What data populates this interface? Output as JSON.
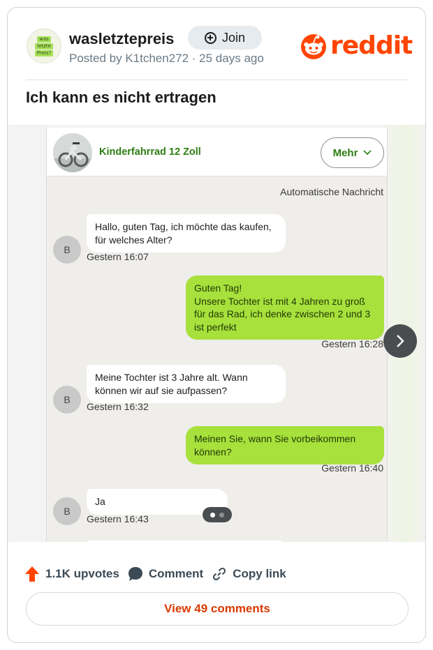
{
  "community": {
    "avatar_lines": [
      "was",
      "letzte",
      "Preis?"
    ],
    "name": "wasletztepreis",
    "join_label": "Join",
    "meta": "Posted by K1tchen272 · 25 days ago"
  },
  "brand": {
    "wordmark": "reddit",
    "color": "#ff4500"
  },
  "post": {
    "title": "Ich kann es nicht ertragen"
  },
  "chat": {
    "product_title": "Kinderfahrrad 12 Zoll",
    "more_label": "Mehr",
    "auto_message": "Automatische Nachricht",
    "avatar_letter": "B",
    "messages": [
      {
        "from": "in",
        "text": "Hallo, guten Tag, ich möchte das kaufen, für welches Alter?",
        "time": "Gestern 16:07"
      },
      {
        "from": "out",
        "text": "Guten Tag!\nUnsere Tochter ist mit 4 Jahren zu groß für das Rad, ich denke zwischen 2 und 3 ist perfekt",
        "time": "Gestern 16:28"
      },
      {
        "from": "in",
        "text": "Meine Tochter ist 3 Jahre alt. Wann können wir auf sie aufpassen?",
        "time": "Gestern 16:32"
      },
      {
        "from": "out",
        "text": "Meinen Sie, wann Sie vorbeikommen können?",
        "time": "Gestern 16:40"
      },
      {
        "from": "in",
        "text": "Ja",
        "time": "Gestern 16:43"
      }
    ]
  },
  "gallery": {
    "current": 1,
    "total": 2
  },
  "footer": {
    "upvotes": "1.1K upvotes",
    "comment": "Comment",
    "copy_link": "Copy link",
    "view_comments": "View 49 comments"
  }
}
